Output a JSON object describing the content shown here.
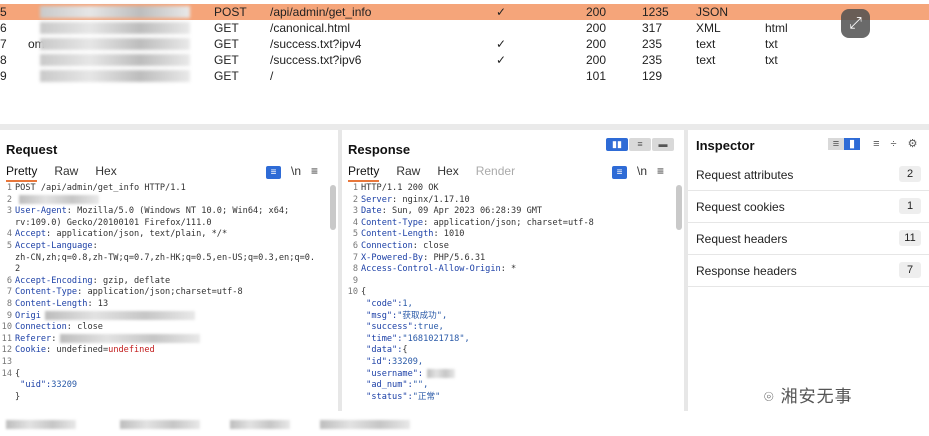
{
  "history": {
    "rows": [
      {
        "num": "5",
        "method": "POST",
        "url": "/api/admin/get_info",
        "check": "✓",
        "status": "200",
        "length": "1235",
        "mime": "JSON",
        "ext": "",
        "selected": true
      },
      {
        "num": "6",
        "method": "GET",
        "url": "/canonical.html",
        "check": "",
        "status": "200",
        "length": "317",
        "mime": "XML",
        "ext": "html",
        "selected": false
      },
      {
        "num": "7",
        "method": "GET",
        "url": "/success.txt?ipv4",
        "check": "✓",
        "status": "200",
        "length": "235",
        "mime": "text",
        "ext": "txt",
        "selected": false
      },
      {
        "num": "8",
        "method": "GET",
        "url": "/success.txt?ipv6",
        "check": "✓",
        "status": "200",
        "length": "235",
        "mime": "text",
        "ext": "txt",
        "selected": false
      },
      {
        "num": "9",
        "method": "GET",
        "url": "/",
        "check": "",
        "status": "101",
        "length": "129",
        "mime": "",
        "ext": "",
        "selected": false
      }
    ],
    "host_suffixes": [
      "",
      "",
      "om",
      "",
      ""
    ],
    "expand_icon": "⤢"
  },
  "request": {
    "title": "Request",
    "tabs": [
      "Pretty",
      "Raw",
      "Hex"
    ],
    "icons": {
      "format": "≡",
      "newline": "\\n",
      "menu": "≡"
    },
    "lines": [
      {
        "n": "1",
        "parts": [
          {
            "t": "POST /api/admin/get_info HTTP/1.1",
            "c": "hv"
          }
        ]
      },
      {
        "n": "2",
        "parts": [
          {
            "t": "",
            "c": "hv"
          }
        ]
      },
      {
        "n": "3",
        "parts": [
          {
            "t": "User-Agent",
            "c": "hk"
          },
          {
            "t": ": Mozilla/5.0 (Windows NT 10.0; Win64; x64;",
            "c": "hv"
          }
        ]
      },
      {
        "n": "",
        "parts": [
          {
            "t": "rv:109.0) Gecko/20100101 Firefox/111.0",
            "c": "hv"
          }
        ]
      },
      {
        "n": "4",
        "parts": [
          {
            "t": "Accept",
            "c": "hk"
          },
          {
            "t": ": application/json, text/plain, */*",
            "c": "hv"
          }
        ]
      },
      {
        "n": "5",
        "parts": [
          {
            "t": "Accept-Language",
            "c": "hk"
          },
          {
            "t": ":",
            "c": "hv"
          }
        ]
      },
      {
        "n": "",
        "parts": [
          {
            "t": "zh-CN,zh;q=0.8,zh-TW;q=0.7,zh-HK;q=0.5,en-US;q=0.3,en;q=0.",
            "c": "hv"
          }
        ]
      },
      {
        "n": "",
        "parts": [
          {
            "t": "2",
            "c": "hv"
          }
        ]
      },
      {
        "n": "6",
        "parts": [
          {
            "t": "Accept-Encoding",
            "c": "hk"
          },
          {
            "t": ": gzip, deflate",
            "c": "hv"
          }
        ]
      },
      {
        "n": "7",
        "parts": [
          {
            "t": "Content-Type",
            "c": "hk"
          },
          {
            "t": ": application/json;charset=utf-8",
            "c": "hv"
          }
        ]
      },
      {
        "n": "8",
        "parts": [
          {
            "t": "Content-Length",
            "c": "hk"
          },
          {
            "t": ": 13",
            "c": "hv"
          }
        ]
      },
      {
        "n": "9",
        "parts": [
          {
            "t": "Origi",
            "c": "hk"
          }
        ]
      },
      {
        "n": "10",
        "parts": [
          {
            "t": "Connection",
            "c": "hk"
          },
          {
            "t": ": close",
            "c": "hv"
          }
        ]
      },
      {
        "n": "11",
        "parts": [
          {
            "t": "Referer",
            "c": "hk"
          },
          {
            "t": ":",
            "c": "hv"
          }
        ]
      },
      {
        "n": "12",
        "parts": [
          {
            "t": "Cookie",
            "c": "hk"
          },
          {
            "t": ": undefined=",
            "c": "hv"
          },
          {
            "t": "undefined",
            "c": "red"
          }
        ]
      },
      {
        "n": "13",
        "parts": [
          {
            "t": "",
            "c": "hv"
          }
        ]
      },
      {
        "n": "14",
        "parts": [
          {
            "t": "{",
            "c": "hv"
          }
        ]
      },
      {
        "n": "",
        "parts": [
          {
            "t": "  \"uid\":",
            "c": "jk"
          },
          {
            "t": "33209",
            "c": "jv"
          }
        ]
      },
      {
        "n": "",
        "parts": [
          {
            "t": "}",
            "c": "hv"
          }
        ]
      }
    ]
  },
  "response": {
    "title": "Response",
    "tabs": [
      "Pretty",
      "Raw",
      "Hex",
      "Render"
    ],
    "icons": {
      "format": "≡",
      "newline": "\\n",
      "menu": "≡"
    },
    "lines": [
      {
        "n": "1",
        "parts": [
          {
            "t": "HTTP/1.1 200 OK",
            "c": "hv"
          }
        ]
      },
      {
        "n": "2",
        "parts": [
          {
            "t": "Server",
            "c": "hk"
          },
          {
            "t": ": nginx/1.17.10",
            "c": "hv"
          }
        ]
      },
      {
        "n": "3",
        "parts": [
          {
            "t": "Date",
            "c": "hk"
          },
          {
            "t": ": Sun, 09 Apr 2023 06:28:39 GMT",
            "c": "hv"
          }
        ]
      },
      {
        "n": "4",
        "parts": [
          {
            "t": "Content-Type",
            "c": "hk"
          },
          {
            "t": ": application/json; charset=utf-8",
            "c": "hv"
          }
        ]
      },
      {
        "n": "5",
        "parts": [
          {
            "t": "Content-Length",
            "c": "hk"
          },
          {
            "t": ": 1010",
            "c": "hv"
          }
        ]
      },
      {
        "n": "6",
        "parts": [
          {
            "t": "Connection",
            "c": "hk"
          },
          {
            "t": ": close",
            "c": "hv"
          }
        ]
      },
      {
        "n": "7",
        "parts": [
          {
            "t": "X-Powered-By",
            "c": "hk"
          },
          {
            "t": ": PHP/5.6.31",
            "c": "hv"
          }
        ]
      },
      {
        "n": "8",
        "parts": [
          {
            "t": "Access-Control-Allow-Origin",
            "c": "hk"
          },
          {
            "t": ": *",
            "c": "hv"
          }
        ]
      },
      {
        "n": "9",
        "parts": [
          {
            "t": "",
            "c": "hv"
          }
        ]
      },
      {
        "n": "10",
        "parts": [
          {
            "t": "{",
            "c": "hv"
          }
        ]
      },
      {
        "n": "",
        "parts": [
          {
            "t": "  \"code\":",
            "c": "jk"
          },
          {
            "t": "1,",
            "c": "jv"
          }
        ]
      },
      {
        "n": "",
        "parts": [
          {
            "t": "  \"msg\":",
            "c": "jk"
          },
          {
            "t": "\"获取成功\",",
            "c": "jv"
          }
        ]
      },
      {
        "n": "",
        "parts": [
          {
            "t": "  \"success\":",
            "c": "jk"
          },
          {
            "t": "true,",
            "c": "jv"
          }
        ]
      },
      {
        "n": "",
        "parts": [
          {
            "t": "  \"time\":",
            "c": "jk"
          },
          {
            "t": "\"1681021718\",",
            "c": "jv"
          }
        ]
      },
      {
        "n": "",
        "parts": [
          {
            "t": "  \"data\":",
            "c": "jk"
          },
          {
            "t": "{",
            "c": "hv"
          }
        ]
      },
      {
        "n": "",
        "parts": [
          {
            "t": "    \"id\":",
            "c": "jk"
          },
          {
            "t": "33209,",
            "c": "jv"
          }
        ]
      },
      {
        "n": "",
        "parts": [
          {
            "t": "    \"username\":",
            "c": "jk"
          },
          {
            "t": "",
            "c": "jv"
          }
        ]
      },
      {
        "n": "",
        "parts": [
          {
            "t": "    \"ad_num\":",
            "c": "jk"
          },
          {
            "t": "\"\",",
            "c": "jv"
          }
        ]
      },
      {
        "n": "",
        "parts": [
          {
            "t": "    \"status\":",
            "c": "jk"
          },
          {
            "t": "\"正常\"",
            "c": "jv"
          }
        ]
      }
    ]
  },
  "inspector": {
    "title": "Inspector",
    "rows": [
      {
        "label": "Request attributes",
        "count": "2"
      },
      {
        "label": "Request cookies",
        "count": "1"
      },
      {
        "label": "Request headers",
        "count": "11"
      },
      {
        "label": "Response headers",
        "count": "7"
      }
    ]
  },
  "watermark": {
    "text": "湘安无事",
    "icon": "wechat-icon"
  },
  "colors": {
    "selected_row": "#f5a57a",
    "accent_blue": "#2e6bd6",
    "tab_underline": "#e8773b"
  }
}
